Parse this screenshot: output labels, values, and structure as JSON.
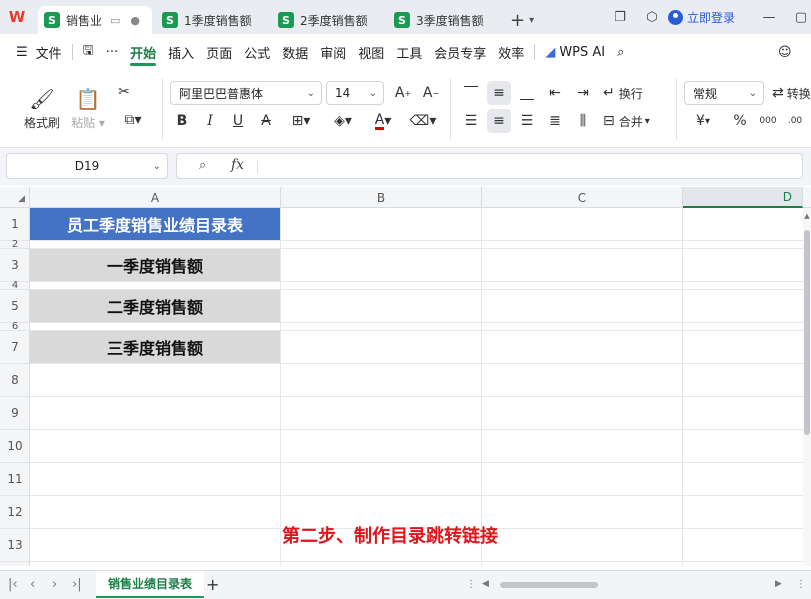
{
  "titlebar": {
    "logo": "W",
    "tabs": [
      {
        "label": "销售业",
        "active": true
      },
      {
        "label": "1季度销售额",
        "active": false
      },
      {
        "label": "2季度销售额",
        "active": false
      },
      {
        "label": "3季度销售额",
        "active": false
      }
    ],
    "login_label": "立即登录"
  },
  "menubar": {
    "file_label": "文件",
    "items": [
      "开始",
      "插入",
      "页面",
      "公式",
      "数据",
      "审阅",
      "视图",
      "工具",
      "会员专享",
      "效率"
    ],
    "active": "开始",
    "wps_ai_label": "WPS AI"
  },
  "ribbon": {
    "format_painter_label": "格式刷",
    "paste_label": "粘贴",
    "font_name": "阿里巴巴普惠体",
    "font_size": "14",
    "wrap_label": "换行",
    "merge_label": "合并",
    "number_format": "常规",
    "convert_label": "转换",
    "percent_symbol": "%",
    "currency_symbol": "¥"
  },
  "formula_bar": {
    "name_box": "D19",
    "fx_label": "fx",
    "value": ""
  },
  "sheet": {
    "columns": [
      "A",
      "B",
      "C",
      "D"
    ],
    "active_column": "D",
    "rows": [
      "1",
      "2",
      "3",
      "4",
      "5",
      "6",
      "7",
      "8",
      "9",
      "10",
      "11",
      "12",
      "13"
    ],
    "cells": {
      "A1": "员工季度销售业绩目录表",
      "A3": "一季度销售额",
      "A5": "二季度销售额",
      "A7": "三季度销售额"
    },
    "colors": {
      "title_fill": "#4472c4",
      "quarter_fill": "#d9d9d9",
      "annotation": "#e0141c"
    }
  },
  "annotation": "第二步、制作目录跳转链接",
  "sheet_tabs": {
    "tabs": [
      "销售业绩目录表"
    ],
    "active": "销售业绩目录表",
    "add_label": "+"
  }
}
